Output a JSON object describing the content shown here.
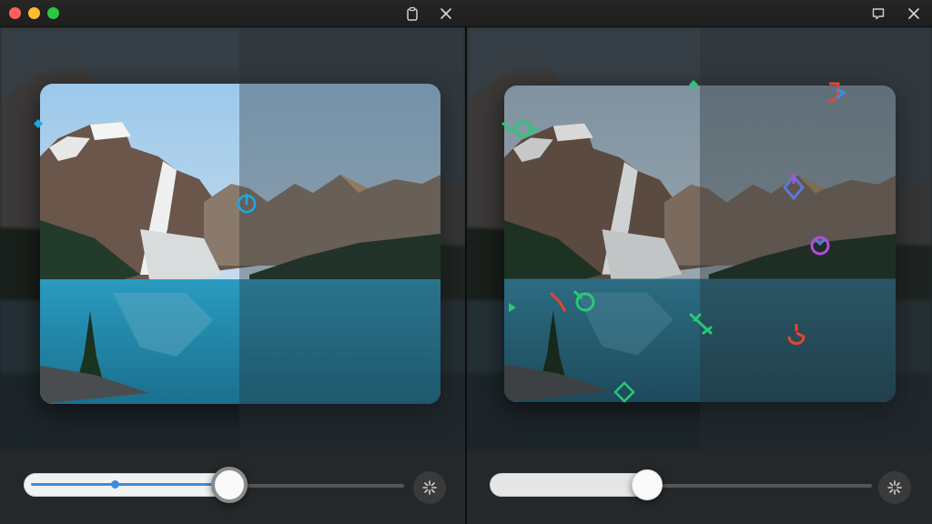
{
  "window": {
    "title": "",
    "left_tool": "clipboard-icon",
    "close_left": "close-icon",
    "right_tool": "comment-icon",
    "close_right": "close-icon"
  },
  "left_panel": {
    "slider_progress": 0.53,
    "reset_button_icon": "sparkle-icon"
  },
  "right_panel": {
    "slider_progress": 0.42,
    "reset_button_icon": "sparkle-icon",
    "markers": [
      {
        "icon": "drag-handle-icon",
        "color": "#28c878"
      },
      {
        "icon": "drag-handle-icon",
        "color": "#28c878"
      },
      {
        "icon": "rotate-handle-icon",
        "color": "#e8452c"
      },
      {
        "icon": "drag-handle-icon",
        "color": "#6a6ae0"
      },
      {
        "icon": "rotate-handle-icon",
        "color": "#b84cd8"
      },
      {
        "icon": "rotate-handle-icon",
        "color": "#e8452c"
      }
    ]
  },
  "colors": {
    "accent_blue": "#3a8dde",
    "marker_green": "#28c878",
    "marker_red": "#e8452c",
    "marker_purple": "#b84cd8",
    "marker_cyan": "#1fa8e0"
  }
}
